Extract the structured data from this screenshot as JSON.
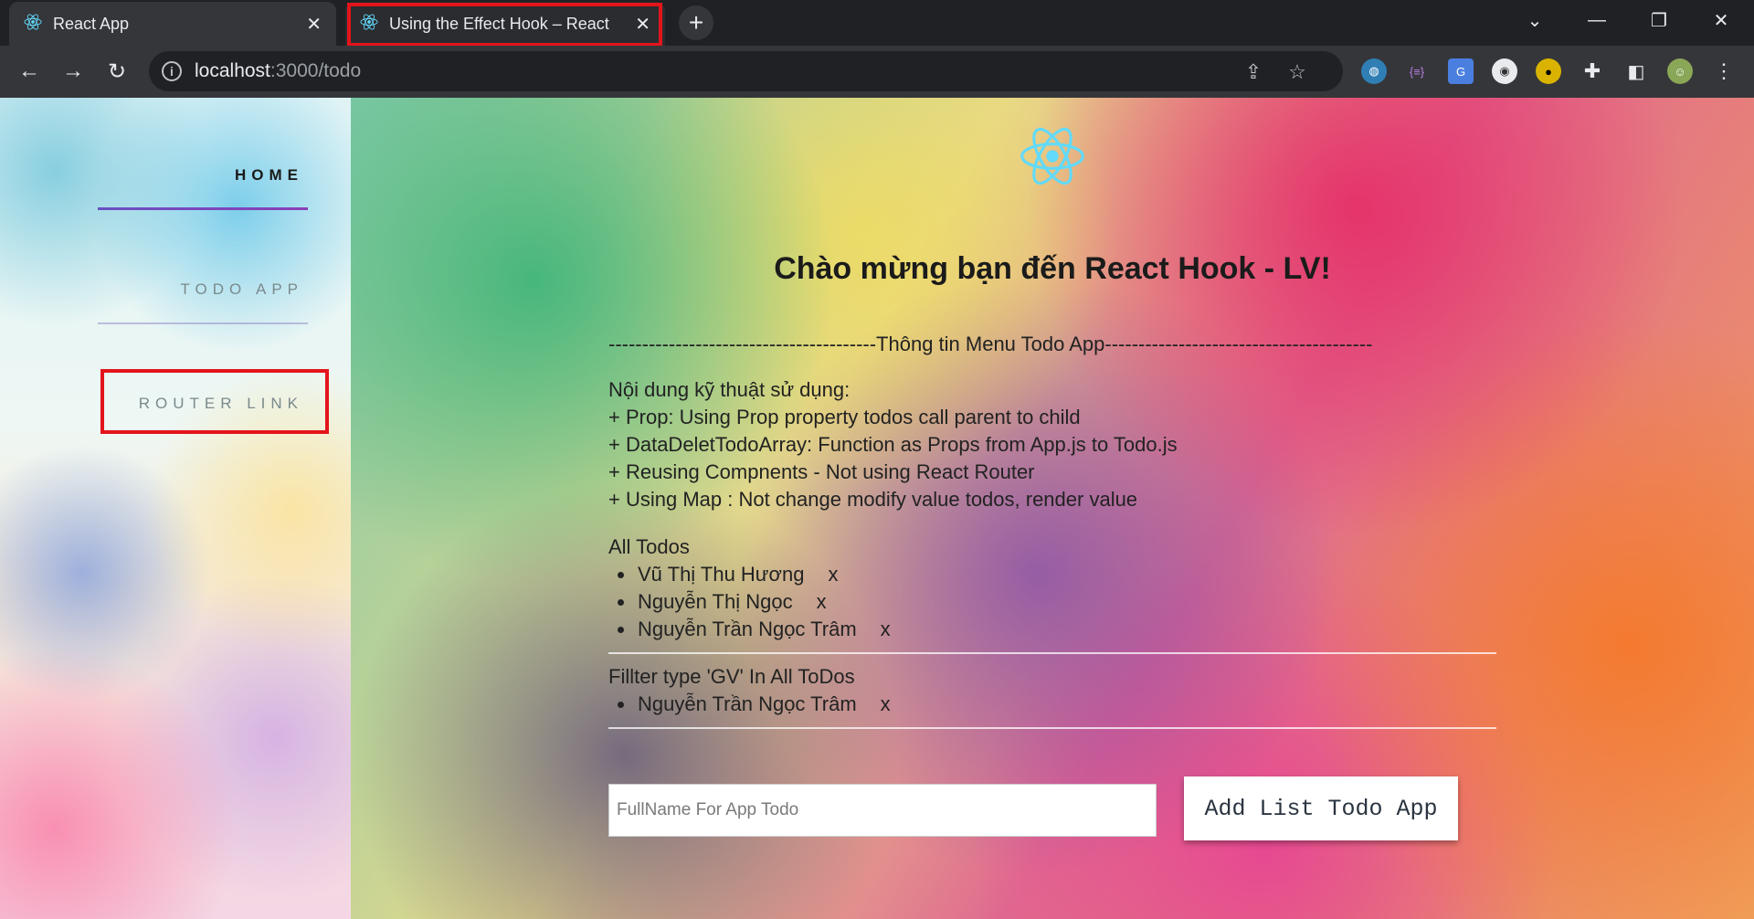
{
  "browser": {
    "tabs": [
      {
        "title": "React App",
        "active": true
      },
      {
        "title": "Using the Effect Hook – React",
        "active": false
      }
    ],
    "url_host": "localhost",
    "url_path": ":3000/todo"
  },
  "sidebar": {
    "home": "HOME",
    "todo_app": "TODO APP",
    "router_link": "ROUTER LINK"
  },
  "main": {
    "heading": "Chào mừng bạn đến React Hook - LV!",
    "menu_title": "----------------------------------------Thông tin Menu Todo App----------------------------------------",
    "desc_title": "Nội dung kỹ thuật sử dụng:",
    "desc_lines": [
      "+ Prop: Using Prop property todos call parent to child",
      "+ DataDeletTodoArray: Function as Props from App.js to Todo.js",
      "+ Reusing Compnents - Not using React Router",
      "+ Using Map : Not change modify value todos, render value"
    ],
    "all_todos_title": "All Todos",
    "all_todos": [
      {
        "name": "Vũ Thị Thu Hương",
        "delete": "x"
      },
      {
        "name": "Nguyễn Thị Ngọc",
        "delete": "x"
      },
      {
        "name": "Nguyễn Trần Ngọc Trâm",
        "delete": "x"
      }
    ],
    "filter_title": "Fillter type 'GV' In All ToDos",
    "filtered_todos": [
      {
        "name": "Nguyễn Trần Ngọc Trâm",
        "delete": "x"
      }
    ],
    "input_placeholder": "FullName For App Todo",
    "input_value": "",
    "add_button": "Add List Todo App"
  },
  "colors": {
    "highlight": "#e3141b",
    "react_blue": "#61dafb",
    "nav_underline_home": "#6a4fc4"
  }
}
